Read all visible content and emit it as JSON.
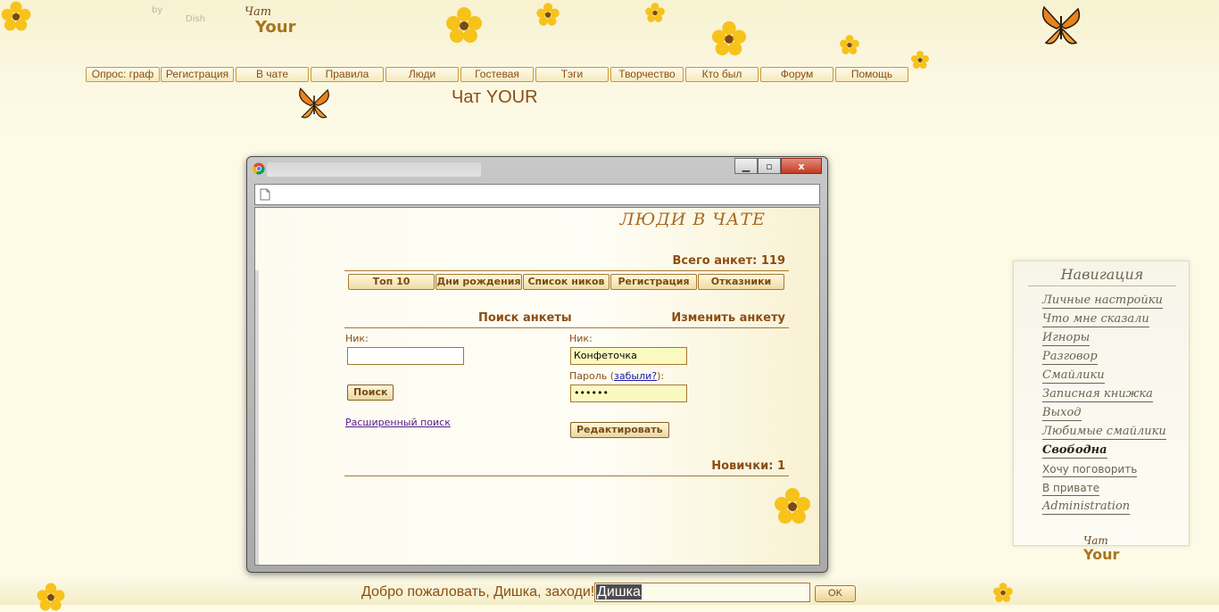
{
  "site": {
    "logo_small": "Чат",
    "logo_big": "Your",
    "byline_by": "by",
    "byline_name": "Dish",
    "title": "Чат YOUR"
  },
  "topnav": [
    {
      "label": "Опрос: граф"
    },
    {
      "label": "Регистрация"
    },
    {
      "label": "В чате"
    },
    {
      "label": "Правила"
    },
    {
      "label": "Люди"
    },
    {
      "label": "Гостевая"
    },
    {
      "label": "Тэги"
    },
    {
      "label": "Творчество"
    },
    {
      "label": "Кто был"
    },
    {
      "label": "Форум"
    },
    {
      "label": "Помощь"
    }
  ],
  "window": {
    "close_symbol": "x",
    "page": {
      "heading": "ЛЮДИ В ЧАТЕ",
      "total": "Всего анкет: 119",
      "tabs": [
        {
          "label": "Топ 10"
        },
        {
          "label": "Дни рождения"
        },
        {
          "label": "Список ников"
        },
        {
          "label": "Регистрация"
        },
        {
          "label": "Отказники"
        }
      ],
      "search": {
        "heading": "Поиск анкеты",
        "nick_label": "Ник:",
        "nick_value": "",
        "button": "Поиск",
        "advanced_link": "Расширенный поиск"
      },
      "edit": {
        "heading": "Изменить анкету",
        "nick_label": "Ник:",
        "nick_value": "Конфеточка",
        "password_label_prefix": "Пароль (",
        "forgot_link": "забыли?",
        "password_label_suffix": "):",
        "password_value": "••••••",
        "button": "Редактировать"
      },
      "novice": "Новички: 1"
    }
  },
  "navpanel": {
    "title": "Навигация",
    "items": [
      {
        "label": "Личные настройки"
      },
      {
        "label": "Что мне сказали"
      },
      {
        "label": "Игноры"
      },
      {
        "label": "Разговор"
      },
      {
        "label": "Смайлики"
      },
      {
        "label": "Записная книжка"
      },
      {
        "label": "Выход"
      },
      {
        "label": "Любимые смайлики"
      },
      {
        "label": "Свободна"
      },
      {
        "label": "Хочу поговорить"
      },
      {
        "label": "В привате"
      },
      {
        "label": "Administration"
      }
    ],
    "logo_small": "Чат",
    "logo_big": "Your"
  },
  "bottom": {
    "welcome": "Добро пожаловать, Дишка, заходи!",
    "input_value": "Дишка",
    "ok_button": "OK"
  },
  "colors": {
    "accent": "#8a4e13",
    "background": "#fdfbe6",
    "flower": "#f7c21a"
  }
}
